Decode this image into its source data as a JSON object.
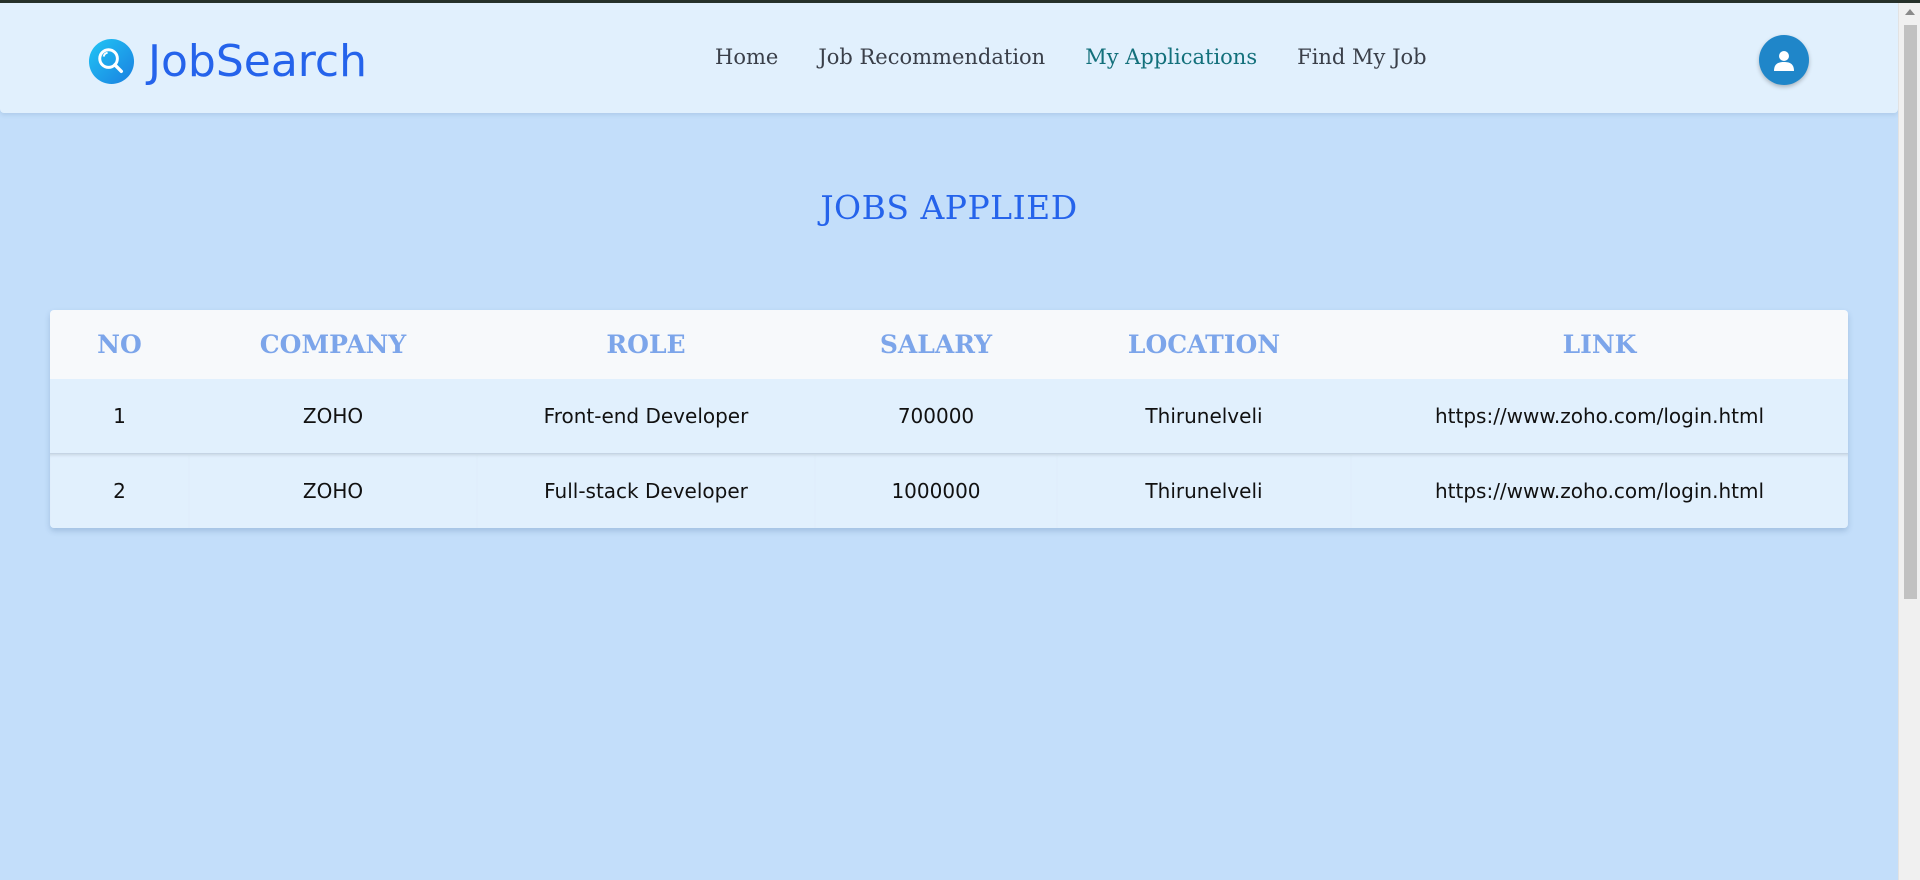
{
  "app": {
    "name": "JobSearch",
    "logo_icon": "search-magnifier-icon"
  },
  "nav": {
    "items": [
      {
        "label": "Home",
        "active": false
      },
      {
        "label": "Job Recommendation",
        "active": false
      },
      {
        "label": "My Applications",
        "active": true
      },
      {
        "label": "Find My Job",
        "active": false
      }
    ]
  },
  "user": {
    "avatar_icon": "user-icon"
  },
  "main": {
    "title": "JOBS APPLIED",
    "table": {
      "headers": [
        "NO",
        "COMPANY",
        "ROLE",
        "SALARY",
        "LOCATION",
        "LINK"
      ],
      "rows": [
        [
          "1",
          "ZOHO",
          "Front-end Developer",
          "700000",
          "Thirunelveli",
          "https://www.zoho.com/login.html"
        ],
        [
          "2",
          "ZOHO",
          "Full-stack Developer",
          "1000000",
          "Thirunelveli",
          "https://www.zoho.com/login.html"
        ]
      ]
    }
  },
  "colors": {
    "page_bg": "#c3defa",
    "header_bg": "#e1f0fd",
    "brand": "#2563eb",
    "active_nav": "#13707b",
    "table_header_text": "#7ca5ea"
  }
}
